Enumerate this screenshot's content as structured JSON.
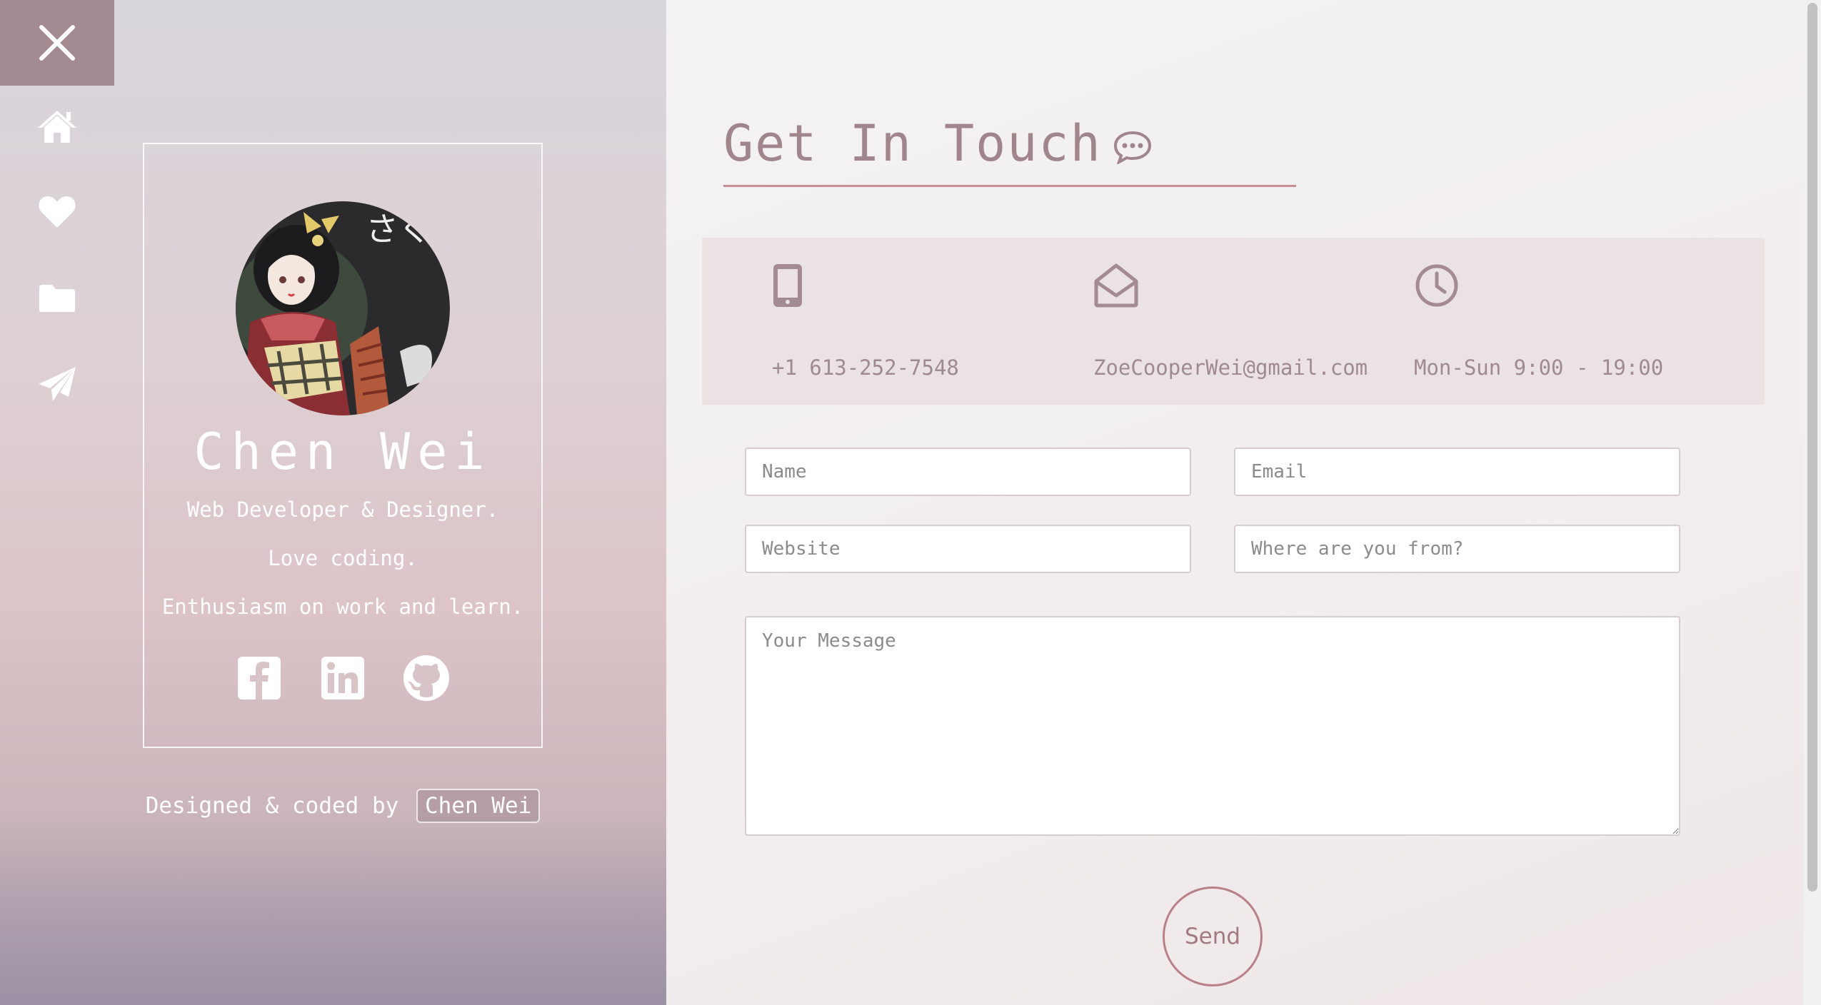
{
  "nav": {
    "close_icon": "close-icon",
    "items": [
      {
        "icon": "home-icon"
      },
      {
        "icon": "heart-icon"
      },
      {
        "icon": "folder-icon"
      },
      {
        "icon": "paper-plane-icon"
      }
    ]
  },
  "profile": {
    "name": "Chen Wei",
    "lines": [
      "Web Developer & Designer.",
      "Love coding.",
      "Enthusiasm on work and learn."
    ],
    "avatar_text": "さくらん",
    "social": [
      {
        "icon": "facebook-icon"
      },
      {
        "icon": "linkedin-icon"
      },
      {
        "icon": "github-icon"
      }
    ]
  },
  "footer": {
    "credit_prefix": "Designed & coded by",
    "credit_author": "Chen Wei"
  },
  "contact": {
    "title": "Get In Touch",
    "info": [
      {
        "icon": "mobile-phone-icon",
        "text": "+1 613-252-7548"
      },
      {
        "icon": "envelope-open-icon",
        "text": "ZoeCooperWei@gmail.com"
      },
      {
        "icon": "clock-icon",
        "text": "Mon-Sun 9:00 - 19:00"
      }
    ],
    "form": {
      "name_placeholder": "Name",
      "email_placeholder": "Email",
      "website_placeholder": "Website",
      "location_placeholder": "Where are you from?",
      "message_placeholder": "Your Message",
      "send_label": "Send"
    }
  },
  "colors": {
    "accent": "#a48a91",
    "title": "#a0868c",
    "underline": "#c48f95",
    "info_bar": "#ebe2e3"
  }
}
